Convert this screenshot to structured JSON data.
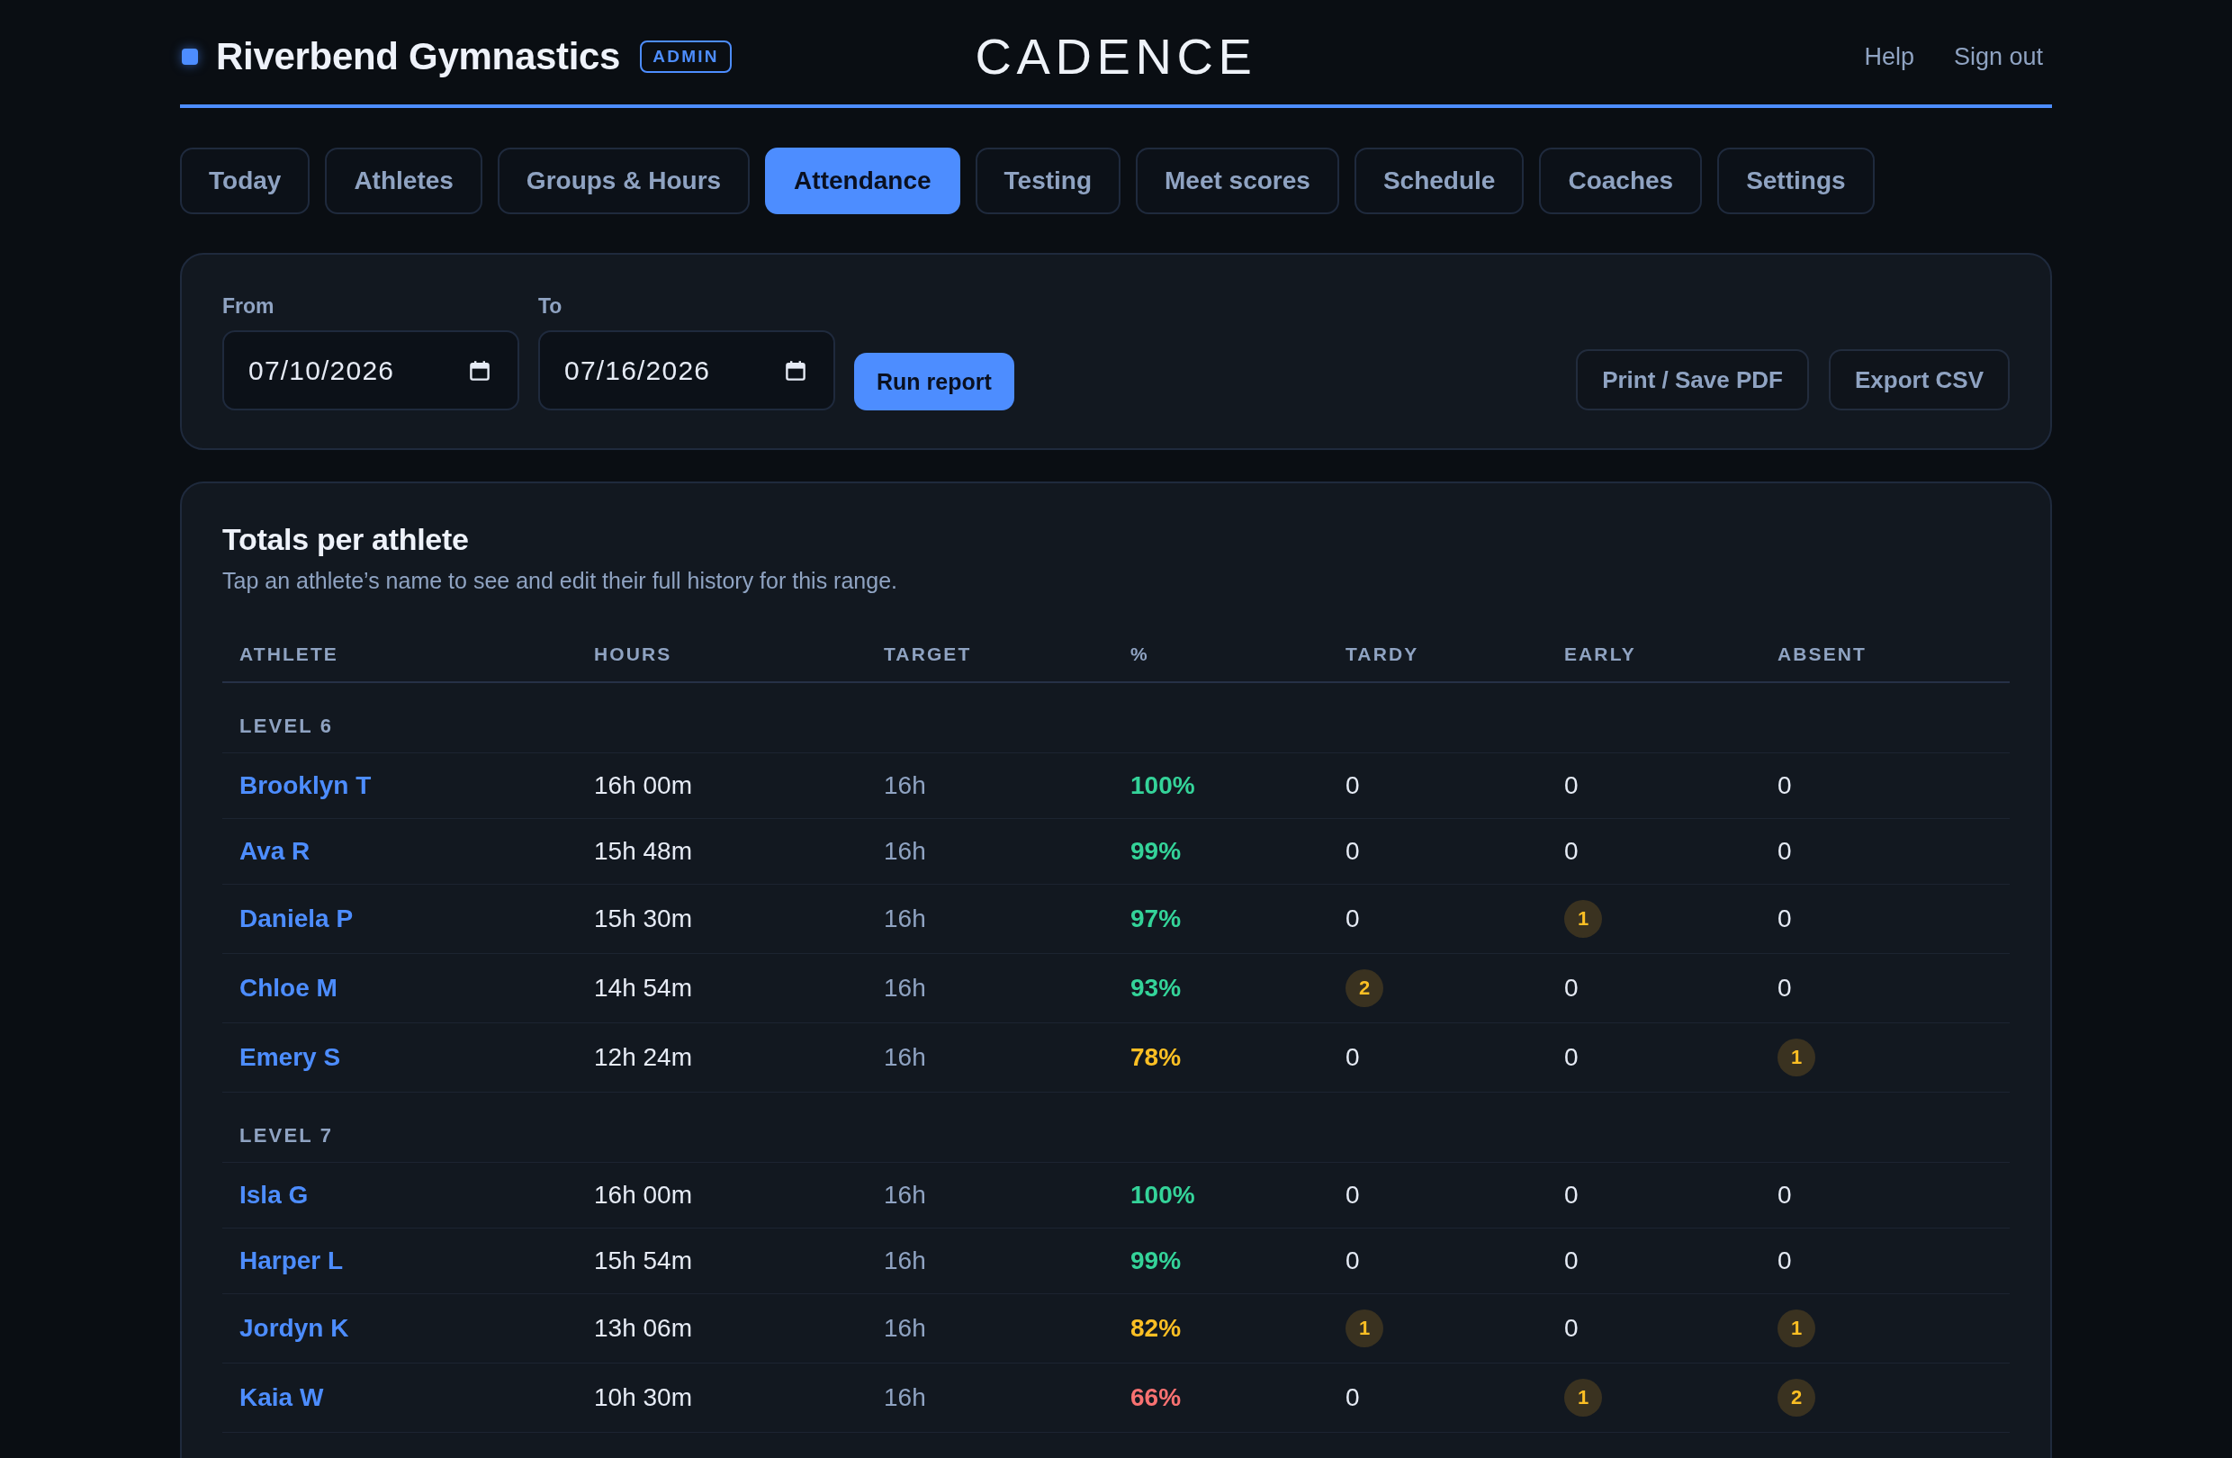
{
  "header": {
    "brand": "Riverbend Gymnastics",
    "role_badge": "ADMIN",
    "logo": "CADENCE",
    "links": [
      "Help",
      "Sign out"
    ]
  },
  "tabs": [
    {
      "label": "Today",
      "selected": false
    },
    {
      "label": "Athletes",
      "selected": false
    },
    {
      "label": "Groups & Hours",
      "selected": false
    },
    {
      "label": "Attendance",
      "selected": true
    },
    {
      "label": "Testing",
      "selected": false
    },
    {
      "label": "Meet scores",
      "selected": false
    },
    {
      "label": "Schedule",
      "selected": false
    },
    {
      "label": "Coaches",
      "selected": false
    },
    {
      "label": "Settings",
      "selected": false
    }
  ],
  "filters": {
    "fields": [
      {
        "label": "From",
        "value": "07/10/2026"
      },
      {
        "label": "To",
        "value": "07/16/2026"
      }
    ],
    "run_button": "Run report",
    "actions": [
      "Print / Save PDF",
      "Export CSV"
    ]
  },
  "totals": {
    "title": "Totals per athlete",
    "subtitle": "Tap an athlete’s name to see and edit their full history for this range.",
    "columns": [
      "ATHLETE",
      "HOURS",
      "TARGET",
      "%",
      "TARDY",
      "EARLY",
      "ABSENT"
    ],
    "groups": [
      {
        "label": "LEVEL 6",
        "rows": [
          {
            "athlete": "Brooklyn T",
            "hours": "16h 00m",
            "target": "16h",
            "percent": "100%",
            "color": "#34d399",
            "tardy": {
              "count": "0",
              "flagged": false
            },
            "early": {
              "count": "0",
              "flagged": false
            },
            "absent": {
              "count": "0",
              "flagged": false
            }
          },
          {
            "athlete": "Ava R",
            "hours": "15h 48m",
            "target": "16h",
            "percent": "99%",
            "color": "#34d399",
            "tardy": {
              "count": "0",
              "flagged": false
            },
            "early": {
              "count": "0",
              "flagged": false
            },
            "absent": {
              "count": "0",
              "flagged": false
            }
          },
          {
            "athlete": "Daniela P",
            "hours": "15h 30m",
            "target": "16h",
            "percent": "97%",
            "color": "#34d399",
            "tardy": {
              "count": "0",
              "flagged": false
            },
            "early": {
              "count": "1",
              "flagged": true
            },
            "absent": {
              "count": "0",
              "flagged": false
            }
          },
          {
            "athlete": "Chloe M",
            "hours": "14h 54m",
            "target": "16h",
            "percent": "93%",
            "color": "#34d399",
            "tardy": {
              "count": "2",
              "flagged": true
            },
            "early": {
              "count": "0",
              "flagged": false
            },
            "absent": {
              "count": "0",
              "flagged": false
            }
          },
          {
            "athlete": "Emery S",
            "hours": "12h 24m",
            "target": "16h",
            "percent": "78%",
            "color": "#fbbf24",
            "tardy": {
              "count": "0",
              "flagged": false
            },
            "early": {
              "count": "0",
              "flagged": false
            },
            "absent": {
              "count": "1",
              "flagged": true
            }
          }
        ]
      },
      {
        "label": "LEVEL 7",
        "rows": [
          {
            "athlete": "Isla G",
            "hours": "16h 00m",
            "target": "16h",
            "percent": "100%",
            "color": "#34d399",
            "tardy": {
              "count": "0",
              "flagged": false
            },
            "early": {
              "count": "0",
              "flagged": false
            },
            "absent": {
              "count": "0",
              "flagged": false
            }
          },
          {
            "athlete": "Harper L",
            "hours": "15h 54m",
            "target": "16h",
            "percent": "99%",
            "color": "#34d399",
            "tardy": {
              "count": "0",
              "flagged": false
            },
            "early": {
              "count": "0",
              "flagged": false
            },
            "absent": {
              "count": "0",
              "flagged": false
            }
          },
          {
            "athlete": "Jordyn K",
            "hours": "13h 06m",
            "target": "16h",
            "percent": "82%",
            "color": "#fbbf24",
            "tardy": {
              "count": "1",
              "flagged": true
            },
            "early": {
              "count": "0",
              "flagged": false
            },
            "absent": {
              "count": "1",
              "flagged": true
            }
          },
          {
            "athlete": "Kaia W",
            "hours": "10h 30m",
            "target": "16h",
            "percent": "66%",
            "color": "#f87171",
            "tardy": {
              "count": "0",
              "flagged": false
            },
            "early": {
              "count": "1",
              "flagged": true
            },
            "absent": {
              "count": "2",
              "flagged": true
            }
          }
        ]
      }
    ]
  }
}
